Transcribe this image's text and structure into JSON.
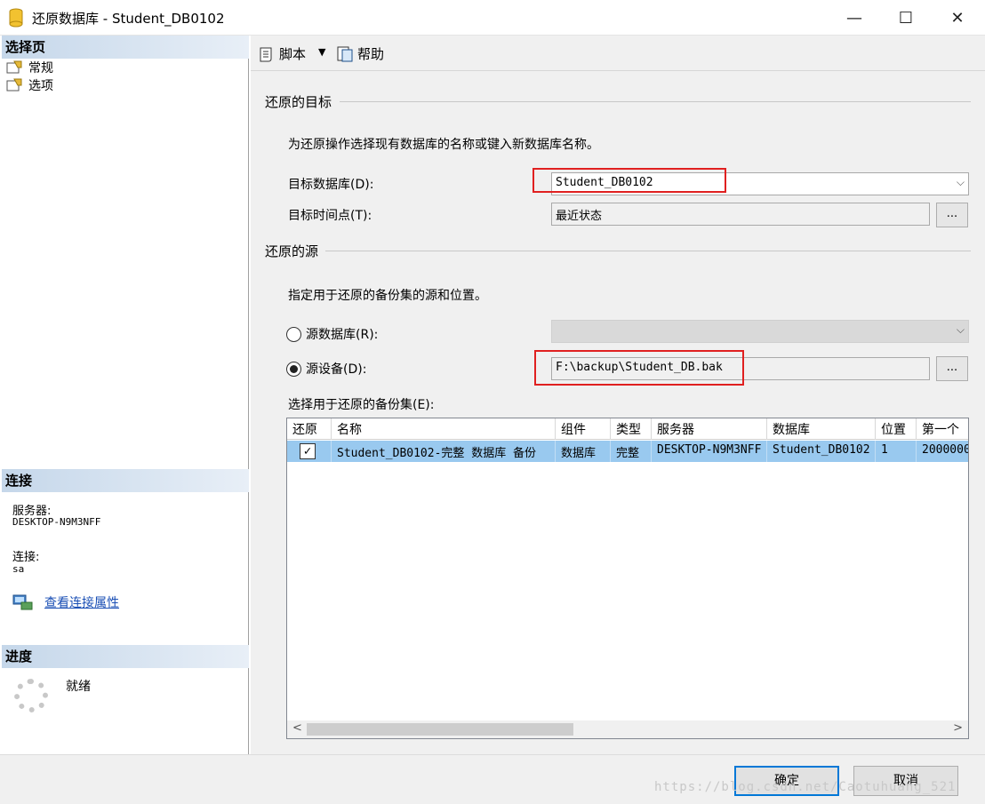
{
  "window": {
    "title": "还原数据库 - Student_DB0102",
    "min": "—",
    "max": "☐",
    "close": "✕"
  },
  "left": {
    "select_page_header": "选择页",
    "pages": [
      {
        "label": "常规"
      },
      {
        "label": "选项"
      }
    ],
    "connection_header": "连接",
    "server_label": "服务器:",
    "server_value": "DESKTOP-N9M3NFF",
    "connection_label": "连接:",
    "connection_value": "sa",
    "view_props_link": "查看连接属性",
    "progress_header": "进度",
    "progress_status": "就绪"
  },
  "toolbar": {
    "script_label": "脚本",
    "dropdown": "▼",
    "help_label": "帮助"
  },
  "target": {
    "group_title": "还原的目标",
    "description": "为还原操作选择现有数据库的名称或键入新数据库名称。",
    "db_label": "目标数据库(D):",
    "db_value": "Student_DB0102",
    "time_label": "目标时间点(T):",
    "time_value": "最近状态",
    "ellipsis": "..."
  },
  "source": {
    "group_title": "还原的源",
    "description": "指定用于还原的备份集的源和位置。",
    "from_db_label": "源数据库(R):",
    "from_device_label": "源设备(D):",
    "device_value": "F:\\backup\\Student_DB.bak",
    "from_device_selected": true,
    "ellipsis": "..."
  },
  "backup_sets": {
    "label": "选择用于还原的备份集(E):",
    "columns": [
      "还原",
      "名称",
      "组件",
      "类型",
      "服务器",
      "数据库",
      "位置",
      "第一个"
    ],
    "rows": [
      {
        "restore": "✓",
        "name": "Student_DB0102-完整 数据库 备份",
        "component": "数据库",
        "type": "完整",
        "server": "DESKTOP-N9M3NFF",
        "database": "Student_DB0102",
        "position": "1",
        "first": "2000000"
      }
    ],
    "scroll_left": "<",
    "scroll_right": ">"
  },
  "footer": {
    "ok_label": "确定",
    "cancel_label": "取消",
    "watermark": "https://blog.csdn.net/Caotuhuang_521"
  },
  "colors": {
    "selection": "#99c9ef",
    "highlight_box": "#e02020",
    "link": "#1a4fb5",
    "default_button_border": "#0078d7"
  },
  "icons": [
    "database-icon",
    "page-icon",
    "script-icon",
    "help-icon",
    "connection-icon",
    "spinner-icon"
  ]
}
